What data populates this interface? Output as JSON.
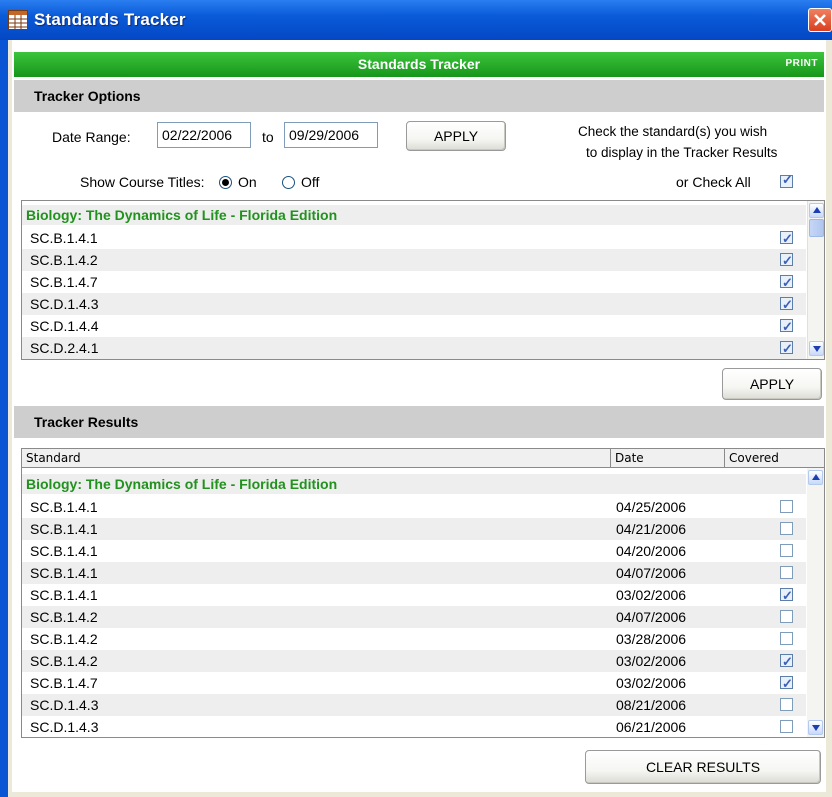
{
  "window": {
    "title": "Standards Tracker",
    "close_icon": "close-icon",
    "app_icon": "grid-icon"
  },
  "header": {
    "title": "Standards Tracker",
    "print": "PRINT"
  },
  "options": {
    "section_title": "Tracker Options",
    "date_range_label": "Date Range:",
    "from_date": "02/22/2006",
    "to_label": "to",
    "to_date": "09/29/2006",
    "apply_label": "APPLY",
    "hint_line1": "Check the standard(s) you wish",
    "hint_line2": "to display in the Tracker Results",
    "show_titles_label": "Show Course Titles:",
    "on_label": "On",
    "off_label": "Off",
    "show_titles_value": "On",
    "check_all_label": "or Check All",
    "check_all_checked": true,
    "group_title": "Biology: The Dynamics of Life - Florida Edition",
    "standards": [
      {
        "code": "SC.B.1.4.1",
        "checked": true
      },
      {
        "code": "SC.B.1.4.2",
        "checked": true
      },
      {
        "code": "SC.B.1.4.7",
        "checked": true
      },
      {
        "code": "SC.D.1.4.3",
        "checked": true
      },
      {
        "code": "SC.D.1.4.4",
        "checked": true
      },
      {
        "code": "SC.D.2.4.1",
        "checked": true
      }
    ],
    "apply_bottom_label": "APPLY"
  },
  "results": {
    "section_title": "Tracker Results",
    "columns": {
      "standard": "Standard",
      "date": "Date",
      "covered": "Covered"
    },
    "group_title": "Biology: The Dynamics of Life - Florida Edition",
    "rows": [
      {
        "code": "SC.B.1.4.1",
        "date": "04/25/2006",
        "covered": false
      },
      {
        "code": "SC.B.1.4.1",
        "date": "04/21/2006",
        "covered": false
      },
      {
        "code": "SC.B.1.4.1",
        "date": "04/20/2006",
        "covered": false
      },
      {
        "code": "SC.B.1.4.1",
        "date": "04/07/2006",
        "covered": false
      },
      {
        "code": "SC.B.1.4.1",
        "date": "03/02/2006",
        "covered": true
      },
      {
        "code": "SC.B.1.4.2",
        "date": "04/07/2006",
        "covered": false
      },
      {
        "code": "SC.B.1.4.2",
        "date": "03/28/2006",
        "covered": false
      },
      {
        "code": "SC.B.1.4.2",
        "date": "03/02/2006",
        "covered": true
      },
      {
        "code": "SC.B.1.4.7",
        "date": "03/02/2006",
        "covered": true
      },
      {
        "code": "SC.D.1.4.3",
        "date": "08/21/2006",
        "covered": false
      },
      {
        "code": "SC.D.1.4.3",
        "date": "06/21/2006",
        "covered": false
      }
    ],
    "clear_label": "CLEAR RESULTS"
  },
  "colors": {
    "title_blue": "#0a5ad8",
    "header_green": "#22a022",
    "group_green": "#22921e",
    "section_grey": "#cecece",
    "row_alt": "#eeeeee"
  }
}
